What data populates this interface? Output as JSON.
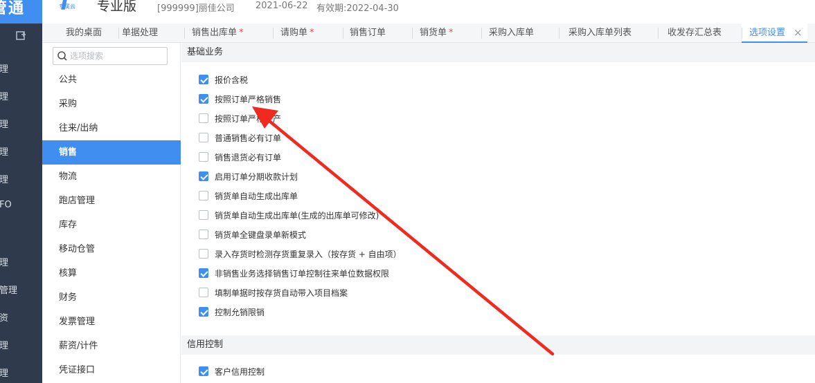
{
  "leftnav": {
    "brand": "管通",
    "plugin_icon": "plugin-icon",
    "items": [
      "理",
      "理",
      "理",
      "理",
      "理",
      "FO",
      "理",
      "管理",
      "资",
      "理",
      "理"
    ]
  },
  "header": {
    "logo_cloud": "专属云",
    "edition": "专业版",
    "company": "[999999]丽佳公司",
    "date": "2021-06-22",
    "valid_until": "有效期:2022-04-30"
  },
  "tabs": [
    {
      "label": "我的桌面",
      "modified": false
    },
    {
      "label": "单据处理",
      "modified": false
    },
    {
      "label": "销售出库单",
      "modified": true
    },
    {
      "label": "请购单",
      "modified": true
    },
    {
      "label": "销售订单",
      "modified": false
    },
    {
      "label": "销货单",
      "modified": true
    },
    {
      "label": "采购入库单",
      "modified": false
    },
    {
      "label": "采购入库单列表",
      "modified": false
    },
    {
      "label": "收发存汇总表",
      "modified": false
    },
    {
      "label": "选项设置",
      "modified": false,
      "active": true
    }
  ],
  "tab_modified_mark": "*",
  "tab_close": "×",
  "search": {
    "placeholder": "选项搜索",
    "value": ""
  },
  "categories": [
    {
      "label": "公共"
    },
    {
      "label": "采购"
    },
    {
      "label": "往来/出纳"
    },
    {
      "label": "销售",
      "active": true
    },
    {
      "label": "物流"
    },
    {
      "label": "跑店管理"
    },
    {
      "label": "库存"
    },
    {
      "label": "移动仓管"
    },
    {
      "label": "核算"
    },
    {
      "label": "财务"
    },
    {
      "label": "发票管理"
    },
    {
      "label": "薪资/计件"
    },
    {
      "label": "凭证接口"
    }
  ],
  "sections": [
    {
      "title": "基础业务",
      "options": [
        {
          "label": "报价含税",
          "checked": true
        },
        {
          "label": "按照订单严格销售",
          "checked": true
        },
        {
          "label": "按照订单严格生产",
          "checked": false
        },
        {
          "label": "普通销售必有订单",
          "checked": false
        },
        {
          "label": "销售退货必有订单",
          "checked": false
        },
        {
          "label": "启用订单分期收款计划",
          "checked": true
        },
        {
          "label": "销货单自动生成出库单",
          "checked": false
        },
        {
          "label": "销货单自动生成出库单(生成的出库单可修改)",
          "checked": false
        },
        {
          "label": "销货单全键盘录单新模式",
          "checked": false
        },
        {
          "label": "录入存货时检测存货重复录入（按存货 + 自由项）",
          "checked": false
        },
        {
          "label": "非销售业务选择销售订单控制往来单位数据权限",
          "checked": true
        },
        {
          "label": "填制单据时按存货自动带入项目档案",
          "checked": false
        },
        {
          "label": "控制允销限销",
          "checked": true
        }
      ]
    },
    {
      "title": "信用控制",
      "options": [
        {
          "label": "客户信用控制",
          "checked": true
        }
      ]
    }
  ],
  "accent_color": "#3f8ef0",
  "annotation_color": "#f02a1e"
}
